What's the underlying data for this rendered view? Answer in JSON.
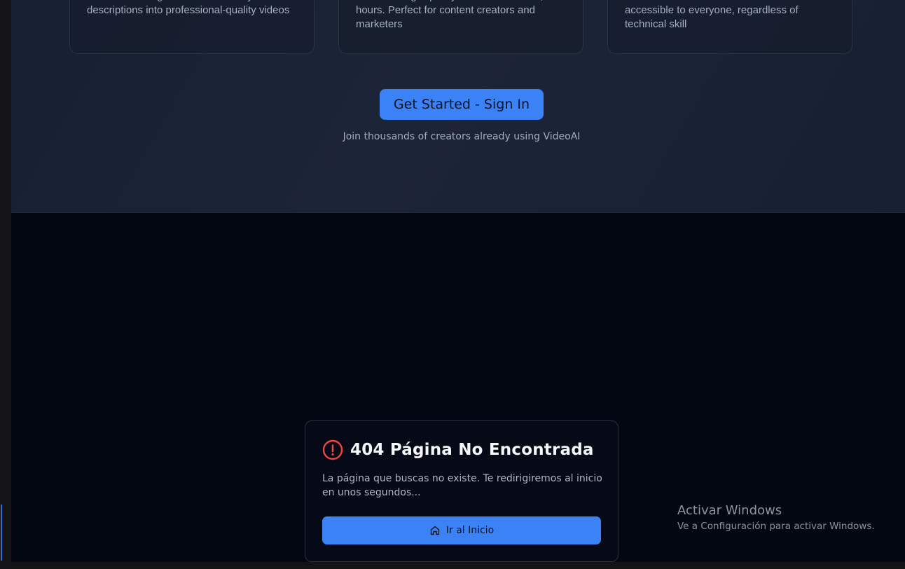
{
  "hero": {
    "features": [
      {
        "description": "Advanced AI algorithms transform your text descriptions into professional-quality videos"
      },
      {
        "description": "Generate high-quality videos in minutes, not hours. Perfect for content creators and marketers"
      },
      {
        "description": "Intuitive interface makes video creation accessible to everyone, regardless of technical skill"
      }
    ],
    "cta_label": "Get Started - Sign In",
    "cta_subtext": "Join thousands of creators already using VideoAI"
  },
  "not_found_modal": {
    "title": "404 Página No Encontrada",
    "message": "La página que buscas no existe. Te redirigiremos al inicio en unos segundos...",
    "home_button_label": "Ir al Inicio",
    "icons": {
      "title": "alert-circle-icon",
      "button": "home-icon"
    }
  },
  "windows_watermark": {
    "title": "Activar Windows",
    "subtitle": "Ve a Configuración para activar Windows."
  },
  "colors": {
    "accent": "#3b82f6",
    "page_bg": "#030712",
    "hero_bg": "#1c2537",
    "error": "#ef4444"
  }
}
